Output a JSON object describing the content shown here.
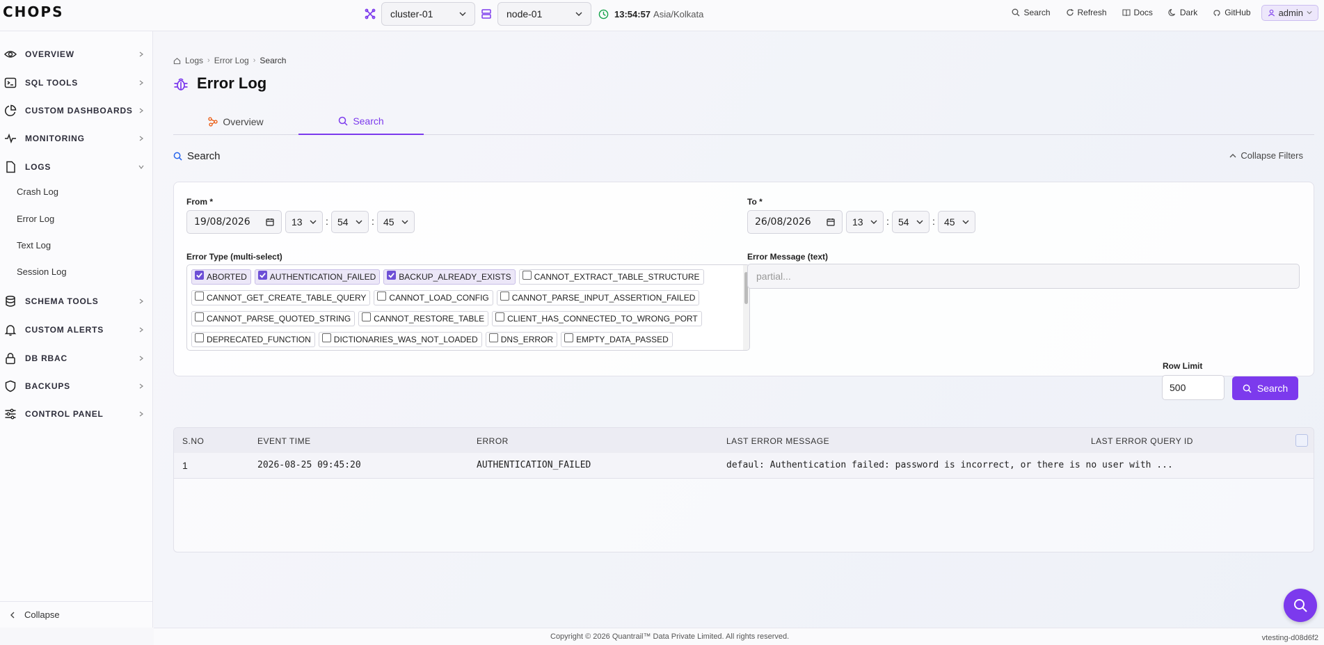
{
  "app": {
    "logo": "CHOPS"
  },
  "topbar": {
    "cluster": "cluster-01",
    "node": "node-01",
    "time": "13:54:57",
    "timezone": "Asia/Kolkata",
    "links": [
      "Search",
      "Refresh",
      "Docs",
      "Dark",
      "GitHub"
    ],
    "user": "admin"
  },
  "sidebar": {
    "items": [
      {
        "label": "OVERVIEW",
        "icon": "eye-icon"
      },
      {
        "label": "SQL TOOLS",
        "icon": "terminal-icon"
      },
      {
        "label": "CUSTOM DASHBOARDS",
        "icon": "pie-chart-icon"
      },
      {
        "label": "MONITORING",
        "icon": "activity-icon"
      },
      {
        "label": "LOGS",
        "icon": "file-icon"
      },
      {
        "label": "SCHEMA TOOLS",
        "icon": "database-icon"
      },
      {
        "label": "CUSTOM ALERTS",
        "icon": "bell-icon"
      },
      {
        "label": "DB RBAC",
        "icon": "lock-icon"
      },
      {
        "label": "BACKUPS",
        "icon": "shield-icon"
      },
      {
        "label": "CONTROL PANEL",
        "icon": "sliders-icon"
      }
    ],
    "log_subitems": [
      "Crash Log",
      "Error Log",
      "Text Log",
      "Session Log"
    ],
    "collapse": "Collapse"
  },
  "breadcrumb": [
    "Logs",
    "Error Log",
    "Search"
  ],
  "page": {
    "title": "Error Log"
  },
  "tabs": [
    "Overview",
    "Search"
  ],
  "search_section": {
    "title": "Search",
    "collapse_filters": "Collapse Filters"
  },
  "filters": {
    "from_label": "From *",
    "from_date": "19/08/2026",
    "from_h": "13",
    "from_m": "54",
    "from_s": "45",
    "to_label": "To *",
    "to_date": "26/08/2026",
    "to_h": "13",
    "to_m": "54",
    "to_s": "45",
    "error_type_label": "Error Type (multi-select)",
    "error_types": [
      [
        {
          "label": "ABORTED",
          "checked": true
        },
        {
          "label": "AUTHENTICATION_FAILED",
          "checked": true
        },
        {
          "label": "BACKUP_ALREADY_EXISTS",
          "checked": true
        },
        {
          "label": "CANNOT_EXTRACT_TABLE_STRUCTURE",
          "checked": false
        }
      ],
      [
        {
          "label": "CANNOT_GET_CREATE_TABLE_QUERY",
          "checked": false
        },
        {
          "label": "CANNOT_LOAD_CONFIG",
          "checked": false
        },
        {
          "label": "CANNOT_PARSE_INPUT_ASSERTION_FAILED",
          "checked": false
        }
      ],
      [
        {
          "label": "CANNOT_PARSE_QUOTED_STRING",
          "checked": false
        },
        {
          "label": "CANNOT_RESTORE_TABLE",
          "checked": false
        },
        {
          "label": "CLIENT_HAS_CONNECTED_TO_WRONG_PORT",
          "checked": false
        }
      ],
      [
        {
          "label": "DEPRECATED_FUNCTION",
          "checked": false
        },
        {
          "label": "DICTIONARIES_WAS_NOT_LOADED",
          "checked": false
        },
        {
          "label": "DNS_ERROR",
          "checked": false
        },
        {
          "label": "EMPTY_DATA_PASSED",
          "checked": false
        }
      ]
    ],
    "error_message_label": "Error Message (text)",
    "error_message_placeholder": "partial...",
    "row_limit_label": "Row Limit",
    "row_limit": "500",
    "search_button": "Search"
  },
  "table": {
    "columns": [
      "S.NO",
      "EVENT TIME",
      "ERROR",
      "LAST ERROR MESSAGE",
      "LAST ERROR QUERY ID"
    ],
    "rows": [
      [
        "1",
        "2026-08-25 09:45:20",
        "AUTHENTICATION_FAILED",
        "defaul: Authentication failed: password is incorrect, or there is no user with ...",
        ""
      ]
    ]
  },
  "footer": {
    "copyright": "Copyright © 2026 Quantrail™ Data Private Limited. All rights reserved.",
    "version": "vtesting-d08d6f2"
  },
  "colors": {
    "accent": "#7c3aed"
  }
}
